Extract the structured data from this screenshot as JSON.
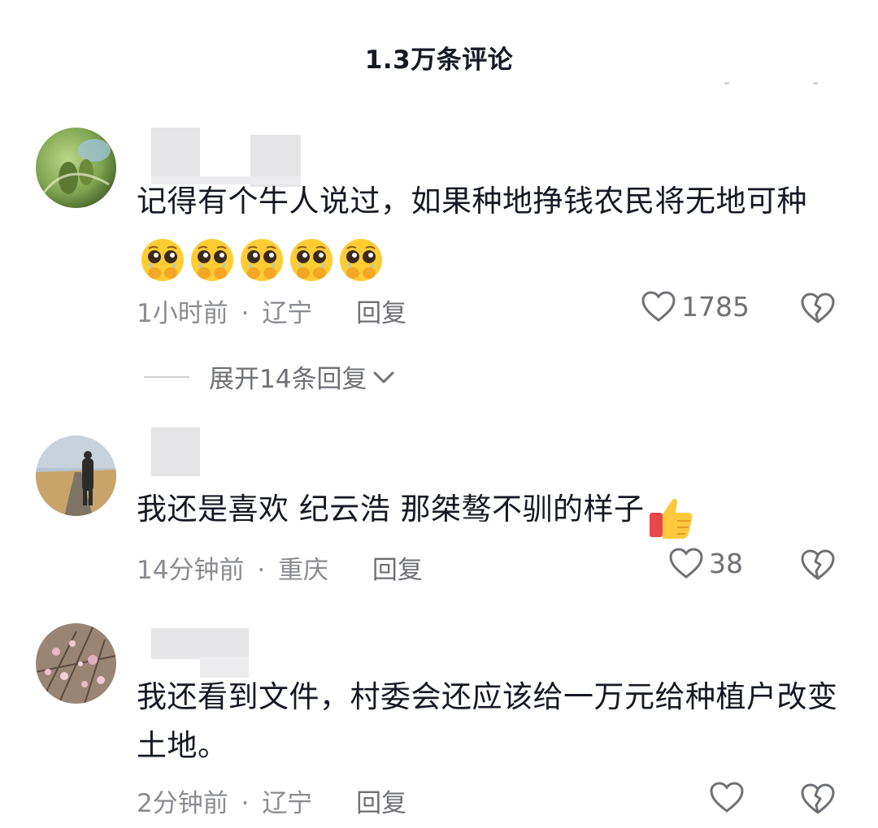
{
  "header": {
    "title": "1.3万条评论"
  },
  "comments": [
    {
      "text": "记得有个牛人说过，如果种地挣钱农民将无地可种",
      "emojis": [
        "pleading-crying-face-emoji",
        "pleading-crying-face-emoji",
        "pleading-crying-face-emoji",
        "pleading-crying-face-emoji",
        "pleading-crying-face-emoji"
      ],
      "time": "1小时前",
      "location": "辽宁",
      "reply_label": "回复",
      "likes": "1785",
      "expand_label": "展开14条回复"
    },
    {
      "text": "我还是喜欢 纪云浩 那桀骜不驯的样子",
      "emojis": [
        "thumbs-up-emoji"
      ],
      "time": "14分钟前",
      "location": "重庆",
      "reply_label": "回复",
      "likes": "38"
    },
    {
      "text": "我还看到文件，村委会还应该给一万元给种植户改变土地。",
      "time": "2分钟前",
      "location": "辽宁",
      "reply_label": "回复",
      "likes": ""
    }
  ],
  "separator": "·",
  "icons": {
    "like": "heart-outline-icon",
    "dislike": "broken-heart-icon",
    "expand": "chevron-down-icon"
  },
  "colors": {
    "text": "#161823",
    "meta": "#8a8b91",
    "secondary": "#6f7076"
  }
}
